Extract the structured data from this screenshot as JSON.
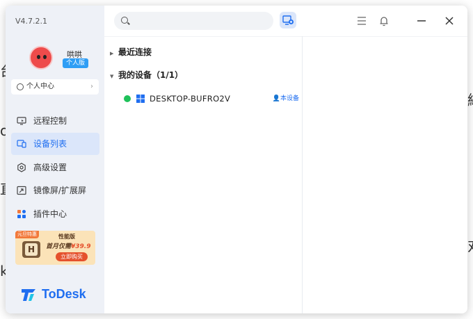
{
  "app": {
    "version": "V4.7.2.1",
    "brand": "ToDesk"
  },
  "user": {
    "name": "哄哄",
    "plan_badge": "个人版",
    "personal_center": "个人中心"
  },
  "nav": {
    "items": [
      {
        "label": "远程控制",
        "icon": "monitor-icon",
        "active": false
      },
      {
        "label": "设备列表",
        "icon": "devices-icon",
        "active": true
      },
      {
        "label": "高级设置",
        "icon": "settings-icon",
        "active": false
      },
      {
        "label": "镜像屏/扩展屏",
        "icon": "mirror-screen-icon",
        "active": false
      },
      {
        "label": "插件中心",
        "icon": "plugins-icon",
        "active": false
      }
    ]
  },
  "promo": {
    "tag": "元旦特惠",
    "title": "性能版",
    "price_prefix": "首月仅需",
    "price": "¥39.9",
    "button": "立即购买"
  },
  "search": {
    "placeholder": ""
  },
  "devices": {
    "recent_label": "最近连接",
    "my_devices_label": "我的设备（1/1）",
    "list": [
      {
        "name": "DESKTOP-BUFRO2V",
        "status": "online",
        "tag": "本设备"
      }
    ]
  },
  "colors": {
    "accent": "#1f6ef0",
    "online": "#1fc15a",
    "sidebar_bg": "#eef1f7"
  }
}
